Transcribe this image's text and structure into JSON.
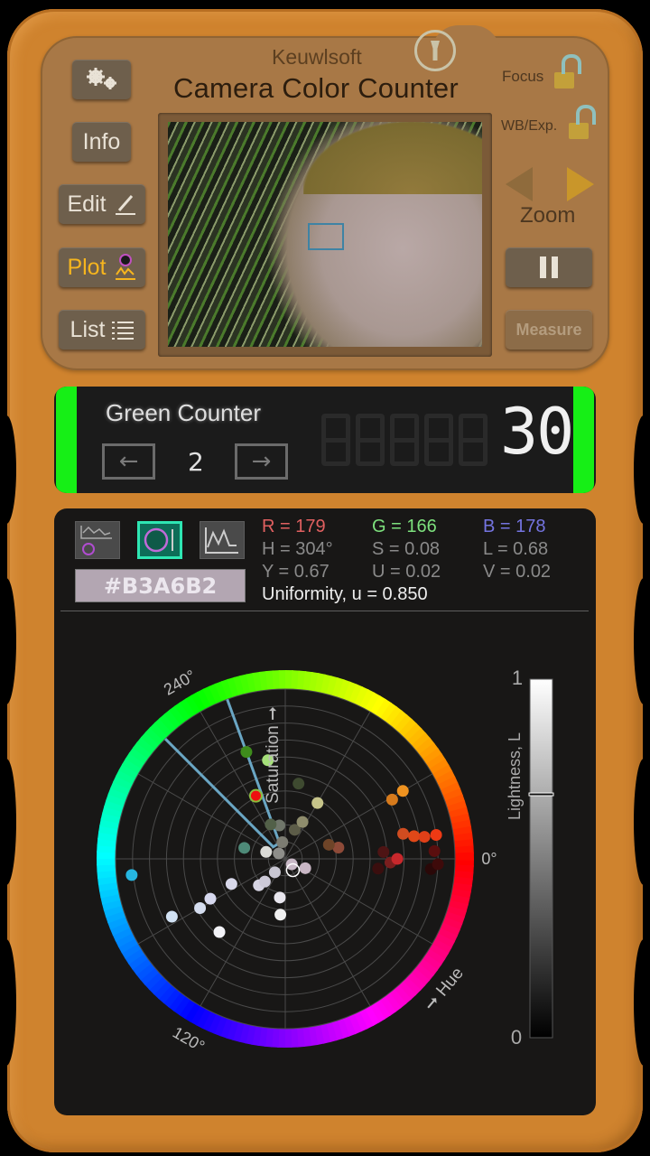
{
  "app": {
    "brand": "Keuwlsoft",
    "title": "Camera Color Counter"
  },
  "left_buttons": [
    {
      "id": "settings",
      "label": "",
      "icon": "gears-icon"
    },
    {
      "id": "info",
      "label": "Info"
    },
    {
      "id": "edit",
      "label": "Edit",
      "icon": "pencil-icon"
    },
    {
      "id": "plot",
      "label": "Plot",
      "icon": "plot-icon",
      "active": true
    },
    {
      "id": "list",
      "label": "List",
      "icon": "list-icon"
    }
  ],
  "right_controls": {
    "focus_label": "Focus",
    "focus_locked": false,
    "wb_label": "WB/Exp.",
    "wb_locked": false,
    "zoom_label": "Zoom",
    "pause_icon": "pause-icon",
    "measure_label": "Measure"
  },
  "counter": {
    "name": "Green Counter",
    "index": "2",
    "prev_icon": "←",
    "next_icon": "→",
    "count": "30",
    "accent": "#16ef16"
  },
  "readout": {
    "hex": "#B3A6B2",
    "swatch": "#B3A6B2",
    "r": "R = 179",
    "g": "G = 166",
    "b": "B = 178",
    "h": "H = 304°",
    "s": "S = 0.08",
    "l": "L = 0.68",
    "y": "Y = 0.67",
    "u": "U = 0.02",
    "v": "V = 0.02",
    "uniformity": "Uniformity, u = 0.850",
    "colors": {
      "r": "#e06060",
      "g": "#7de07d",
      "b": "#7474e0",
      "dim": "#8a8a8a"
    }
  },
  "plot_modes": [
    {
      "id": "combined",
      "icon": "combined-plot-icon",
      "selected": false
    },
    {
      "id": "hue-wheel",
      "icon": "hue-wheel-icon",
      "selected": true
    },
    {
      "id": "spectrum",
      "icon": "line-plot-icon",
      "selected": false
    }
  ],
  "chart_data": {
    "type": "scatter",
    "title": "",
    "polar": true,
    "angle_axis": {
      "label": "Hue",
      "ticks": [
        "0°",
        "120°",
        "240°"
      ],
      "direction": "clockwise-from-right"
    },
    "radial_axis": {
      "label": "Saturation",
      "range": [
        0,
        1
      ],
      "rings": 10
    },
    "lightness_bar": {
      "label": "Lightness, L",
      "min_label": "0",
      "max_label": "1",
      "marker": 0.68
    },
    "current": {
      "hue": 304,
      "sat": 0.08
    },
    "selection_wedge": {
      "hue_from": 110,
      "hue_to": 135,
      "sat_from": 0.1,
      "sat_to": 1.0,
      "color": "#6aa6c4"
    },
    "points": [
      {
        "hue": 228,
        "sat": 0.58,
        "color": "#f2f2f6"
      },
      {
        "hue": 207,
        "sat": 0.75,
        "color": "#d2e2f4"
      },
      {
        "hue": 210,
        "sat": 0.58,
        "color": "#d4dcee"
      },
      {
        "hue": 208,
        "sat": 0.5,
        "color": "#d6d8ee"
      },
      {
        "hue": 205,
        "sat": 0.35,
        "color": "#d8d8ea"
      },
      {
        "hue": 186,
        "sat": 0.91,
        "color": "#26b6e0"
      },
      {
        "hue": 265,
        "sat": 0.33,
        "color": "#f0f0f0"
      },
      {
        "hue": 262,
        "sat": 0.23,
        "color": "#e8e6ee"
      },
      {
        "hue": 225,
        "sat": 0.22,
        "color": "#d6d4e2"
      },
      {
        "hue": 228,
        "sat": 0.18,
        "color": "#cdcad8"
      },
      {
        "hue": 232,
        "sat": 0.1,
        "color": "#c8c6d2"
      },
      {
        "hue": 320,
        "sat": 0.05,
        "color": "#c8b8c6"
      },
      {
        "hue": 335,
        "sat": 0.13,
        "color": "#c8b6c4"
      },
      {
        "hue": 140,
        "sat": 0.05,
        "color": "#8e8e8a"
      },
      {
        "hue": 160,
        "sat": 0.12,
        "color": "#dcdcd8"
      },
      {
        "hue": 100,
        "sat": 0.1,
        "color": "#7c7c72"
      },
      {
        "hue": 100,
        "sat": 0.2,
        "color": "#70766a"
      },
      {
        "hue": 72,
        "sat": 0.18,
        "color": "#5c5c48"
      },
      {
        "hue": 65,
        "sat": 0.24,
        "color": "#8e8c6c"
      },
      {
        "hue": 60,
        "sat": 0.38,
        "color": "#c6c48a"
      },
      {
        "hue": 80,
        "sat": 0.45,
        "color": "#3e4a30"
      },
      {
        "hue": 113,
        "sat": 0.22,
        "color": "#526048"
      },
      {
        "hue": 165,
        "sat": 0.25,
        "color": "#4e8a78"
      },
      {
        "hue": 12,
        "sat": 0.32,
        "color": "#8e4a38"
      },
      {
        "hue": 18,
        "sat": 0.27,
        "color": "#6e4428"
      },
      {
        "hue": 354,
        "sat": 0.55,
        "color": "#3a0e0e"
      },
      {
        "hue": 358,
        "sat": 0.62,
        "color": "#7a1e1e"
      },
      {
        "hue": 0,
        "sat": 0.66,
        "color": "#c8282c"
      },
      {
        "hue": 4,
        "sat": 0.58,
        "color": "#4e1414"
      },
      {
        "hue": 356,
        "sat": 0.86,
        "color": "#2a0808"
      },
      {
        "hue": 358,
        "sat": 0.9,
        "color": "#3e0a0a"
      },
      {
        "hue": 3,
        "sat": 0.88,
        "color": "#5a0e0e"
      },
      {
        "hue": 12,
        "sat": 0.71,
        "color": "#d04c20"
      },
      {
        "hue": 10,
        "sat": 0.77,
        "color": "#e04818"
      },
      {
        "hue": 9,
        "sat": 0.83,
        "color": "#e04018"
      },
      {
        "hue": 9,
        "sat": 0.9,
        "color": "#ee3a14"
      },
      {
        "hue": 29,
        "sat": 0.72,
        "color": "#d67a1c"
      },
      {
        "hue": 30,
        "sat": 0.8,
        "color": "#ee9220"
      },
      {
        "hue": 115,
        "sat": 0.41,
        "color": "#ee1010",
        "ring": "#8cbc3c"
      },
      {
        "hue": 100,
        "sat": 0.59,
        "color": "#a6e07a"
      },
      {
        "hue": 110,
        "sat": 0.67,
        "color": "#3e8c1c"
      }
    ]
  }
}
